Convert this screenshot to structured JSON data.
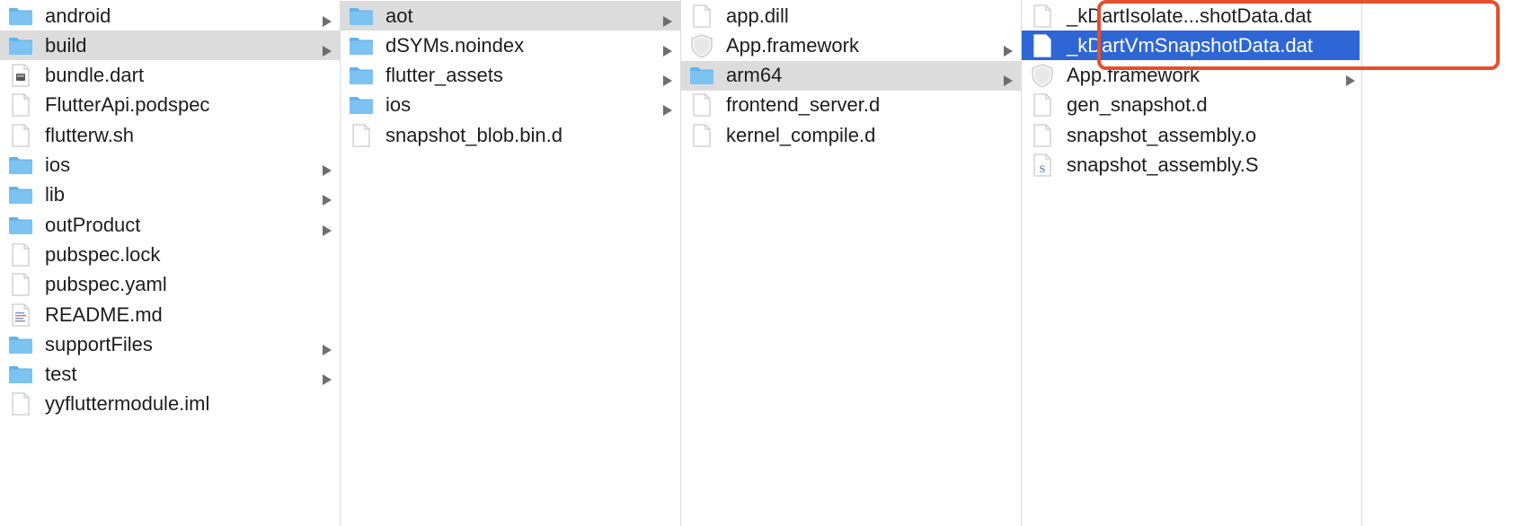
{
  "window": {
    "columns": [
      {
        "items": [
          {
            "name": "android",
            "kind": "folder",
            "has_children": true
          },
          {
            "name": "build",
            "kind": "folder",
            "has_children": true,
            "state": "expanded"
          },
          {
            "name": "bundle.dart",
            "kind": "dart-file"
          },
          {
            "name": "FlutterApi.podspec",
            "kind": "file"
          },
          {
            "name": "flutterw.sh",
            "kind": "file"
          },
          {
            "name": "ios",
            "kind": "folder",
            "has_children": true
          },
          {
            "name": "lib",
            "kind": "folder",
            "has_children": true
          },
          {
            "name": "outProduct",
            "kind": "folder",
            "has_children": true
          },
          {
            "name": "pubspec.lock",
            "kind": "file"
          },
          {
            "name": "pubspec.yaml",
            "kind": "file"
          },
          {
            "name": "README.md",
            "kind": "text-file"
          },
          {
            "name": "supportFiles",
            "kind": "folder",
            "has_children": true
          },
          {
            "name": "test",
            "kind": "folder",
            "has_children": true
          },
          {
            "name": "yyfluttermodule.iml",
            "kind": "file"
          }
        ]
      },
      {
        "items": [
          {
            "name": "aot",
            "kind": "folder",
            "has_children": true,
            "state": "expanded"
          },
          {
            "name": "dSYMs.noindex",
            "kind": "folder",
            "has_children": true
          },
          {
            "name": "flutter_assets",
            "kind": "folder",
            "has_children": true
          },
          {
            "name": "ios",
            "kind": "folder",
            "has_children": true
          },
          {
            "name": "snapshot_blob.bin.d",
            "kind": "file"
          }
        ]
      },
      {
        "items": [
          {
            "name": "app.dill",
            "kind": "file"
          },
          {
            "name": "App.framework",
            "kind": "framework",
            "has_children": true
          },
          {
            "name": "arm64",
            "kind": "folder",
            "has_children": true,
            "state": "expanded"
          },
          {
            "name": "frontend_server.d",
            "kind": "file"
          },
          {
            "name": "kernel_compile.d",
            "kind": "file"
          }
        ]
      },
      {
        "items": [
          {
            "name": "_kDartIsolate...shotData.dat",
            "kind": "file"
          },
          {
            "name": "_kDartVmSnapshotData.dat",
            "kind": "file",
            "state": "selected"
          },
          {
            "name": "App.framework",
            "kind": "framework",
            "has_children": true
          },
          {
            "name": "gen_snapshot.d",
            "kind": "file"
          },
          {
            "name": "snapshot_assembly.o",
            "kind": "file"
          },
          {
            "name": "snapshot_assembly.S",
            "kind": "asm-file"
          }
        ]
      }
    ]
  },
  "colors": {
    "selection": "#2f66d6",
    "expanded_row": "#dcdcdc",
    "annotation_box": "#e2502e",
    "folder": "#7cc3f2"
  },
  "annotation": {
    "shape": "rounded-rectangle",
    "color": "#e2502e",
    "encloses": [
      "_kDartIsolate...shotData.dat",
      "_kDartVmSnapshotData.dat"
    ]
  }
}
